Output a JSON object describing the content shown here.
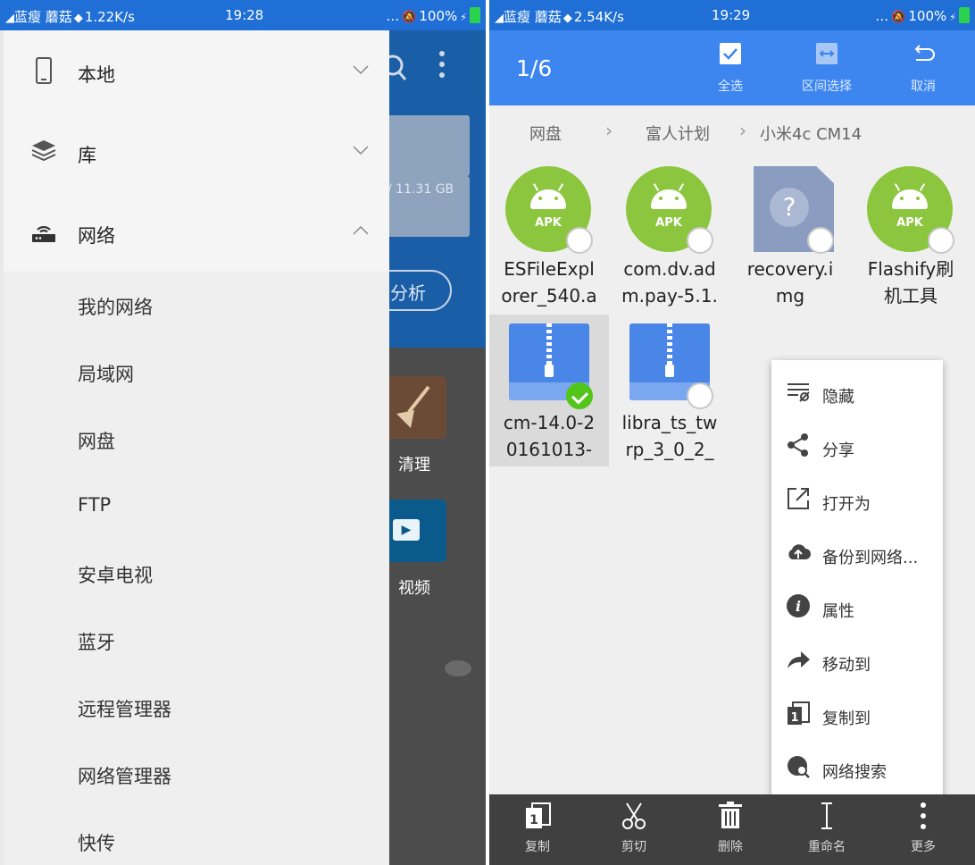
{
  "left_status": {
    "carrier": "蓝瘦",
    "network_name": "蘑菇",
    "speed": "1.22K/s",
    "time": "19:28",
    "battery": "100%"
  },
  "right_status": {
    "carrier": "蓝瘦",
    "network_name": "蘑菇",
    "speed": "2.54K/s",
    "time": "19:29",
    "battery": "100%"
  },
  "background_app": {
    "storage_text": "/ 11.31 GB",
    "analyze_label": "分析",
    "clean_label": "清理",
    "video_label": "视频"
  },
  "drawer": {
    "sections": [
      {
        "label": "本地",
        "icon": "phone-icon",
        "expanded": false
      },
      {
        "label": "库",
        "icon": "layers-icon",
        "expanded": false
      },
      {
        "label": "网络",
        "icon": "router-icon",
        "expanded": true
      }
    ],
    "network_items": [
      {
        "label": "我的网络"
      },
      {
        "label": "局域网"
      },
      {
        "label": "网盘"
      },
      {
        "label": "FTP"
      },
      {
        "label": "安卓电视"
      },
      {
        "label": "蓝牙"
      },
      {
        "label": "远程管理器"
      },
      {
        "label": "网络管理器"
      },
      {
        "label": "快传"
      }
    ]
  },
  "selection_bar": {
    "count": "1/6",
    "select_all": "全选",
    "range_select": "区间选择",
    "cancel": "取消"
  },
  "breadcrumb": [
    "网盘",
    "富人计划",
    "小米4c CM14"
  ],
  "files": [
    {
      "name_line1": "ESFileExpl",
      "name_line2": "orer_540.a",
      "type": "apk",
      "type_label": "APK",
      "selected": false
    },
    {
      "name_line1": "com.dv.ad",
      "name_line2": "m.pay-5.1.",
      "type": "apk",
      "type_label": "APK",
      "selected": false
    },
    {
      "name_line1": "recovery.i",
      "name_line2": "mg",
      "type": "unknown",
      "type_label": "?",
      "selected": false
    },
    {
      "name_line1": "Flashify刷",
      "name_line2": "机工具",
      "type": "apk",
      "type_label": "APK",
      "selected": false
    },
    {
      "name_line1": "cm-14.0-2",
      "name_line2": "0161013-",
      "type": "zip",
      "selected": true
    },
    {
      "name_line1": "libra_ts_tw",
      "name_line2": "rp_3_0_2_",
      "type": "zip",
      "selected": false
    }
  ],
  "context_menu": [
    {
      "label": "隐藏",
      "icon": "hide-icon"
    },
    {
      "label": "分享",
      "icon": "share-icon"
    },
    {
      "label": "打开为",
      "icon": "open-as-icon"
    },
    {
      "label": "备份到网络...",
      "icon": "cloud-upload-icon"
    },
    {
      "label": "属性",
      "icon": "info-icon"
    },
    {
      "label": "移动到",
      "icon": "move-icon"
    },
    {
      "label": "复制到",
      "icon": "copy-to-icon"
    },
    {
      "label": "网络搜索",
      "icon": "web-search-icon"
    }
  ],
  "bottom_bar": [
    {
      "label": "复制",
      "icon": "copy-icon"
    },
    {
      "label": "剪切",
      "icon": "scissors-icon"
    },
    {
      "label": "删除",
      "icon": "trash-icon"
    },
    {
      "label": "重命名",
      "icon": "rename-icon"
    },
    {
      "label": "更多",
      "icon": "more-icon"
    }
  ],
  "colors": {
    "status_bar": "#1f6fd6",
    "action_bar": "#3d86f0",
    "apk_green": "#8cc63e",
    "zip_blue": "#4a86e8",
    "check_green": "#52c41a",
    "bottom_bar": "#404040"
  }
}
